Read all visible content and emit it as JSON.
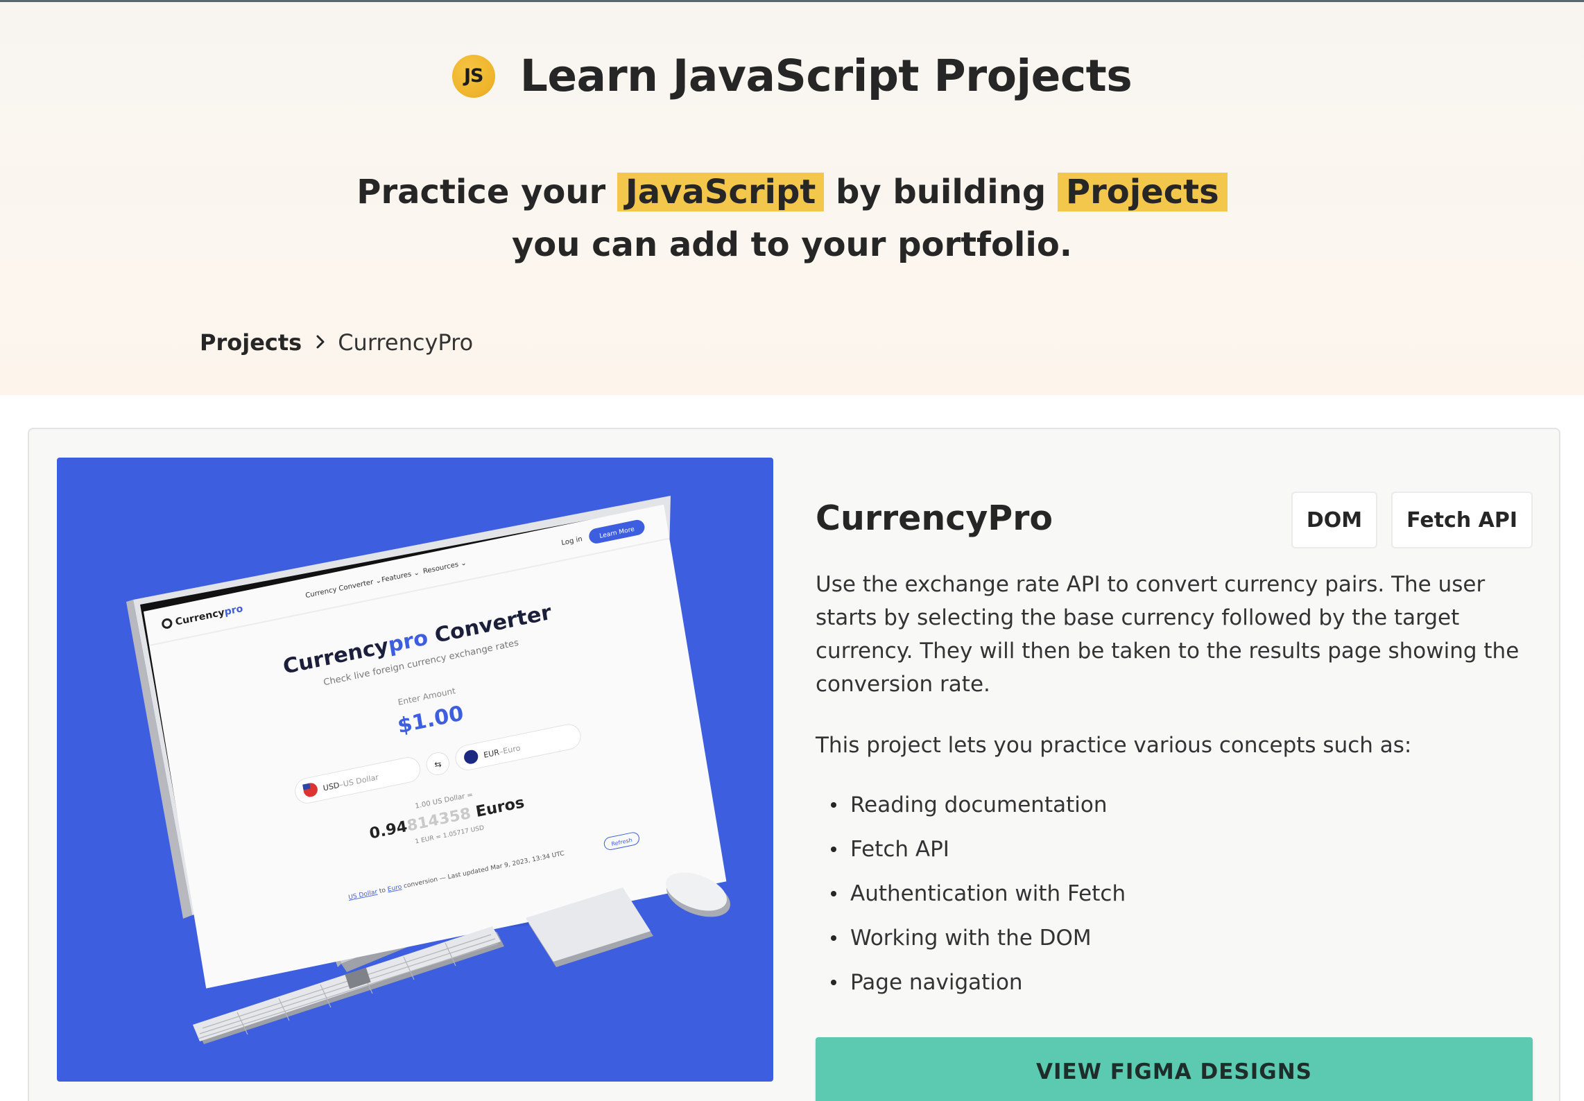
{
  "header": {
    "logo_text": "JS",
    "title": "Learn JavaScript Projects"
  },
  "tagline": {
    "part1": "Practice your",
    "highlight1": "JavaScript",
    "part2": "by building",
    "highlight2": "Projects",
    "line2": "you can add to your portfolio."
  },
  "breadcrumb": {
    "root": "Projects",
    "current": "CurrencyPro"
  },
  "project": {
    "title": "CurrencyPro",
    "tags": [
      "DOM",
      "Fetch API"
    ],
    "description": "Use the exchange rate API to convert currency pairs. The user starts by selecting the base currency followed by the target currency. They will then be taken to the results page showing the conversion rate.",
    "concepts_intro": "This project lets you practice various concepts such as:",
    "concepts": [
      "Reading documentation",
      "Fetch API",
      "Authentication with Fetch",
      "Working with the DOM",
      "Page navigation"
    ],
    "cta_label": "VIEW FIGMA DESIGNS"
  },
  "preview": {
    "brand_part1": "Currency",
    "brand_part2": "pro",
    "nav": [
      "Currency Converter ⌄",
      "Features ⌄",
      "Resources ⌄"
    ],
    "login": "Log in",
    "learn_more": "Learn More",
    "heading_part1": "Currency",
    "heading_part2": "pro",
    "heading_part3": " Converter",
    "subheading": "Check live foreign currency exchange rates",
    "amount_label": "Enter Amount",
    "amount": "$1.00",
    "from_currency_code": "USD",
    "from_currency_name": "–US Dollar",
    "to_currency_code": "EUR",
    "to_currency_name": "–Euro",
    "result_caption": "1.00 US Dollar =",
    "result_main": "0.94",
    "result_faded": "814358",
    "result_unit": " Euros",
    "rate_line": "1 EUR = 1.05717 USD",
    "footer_link1": "US Dollar",
    "footer_to": " to ",
    "footer_link2": "Euro",
    "footer_rest": " conversion — Last updated Mar 9, 2023, 13:34 UTC",
    "refresh": "Refresh"
  },
  "colors": {
    "highlight": "#f3c64c",
    "preview_bg": "#3e5ee0",
    "cta": "#5cc9b1",
    "accent_blue": "#3e5ee0"
  }
}
